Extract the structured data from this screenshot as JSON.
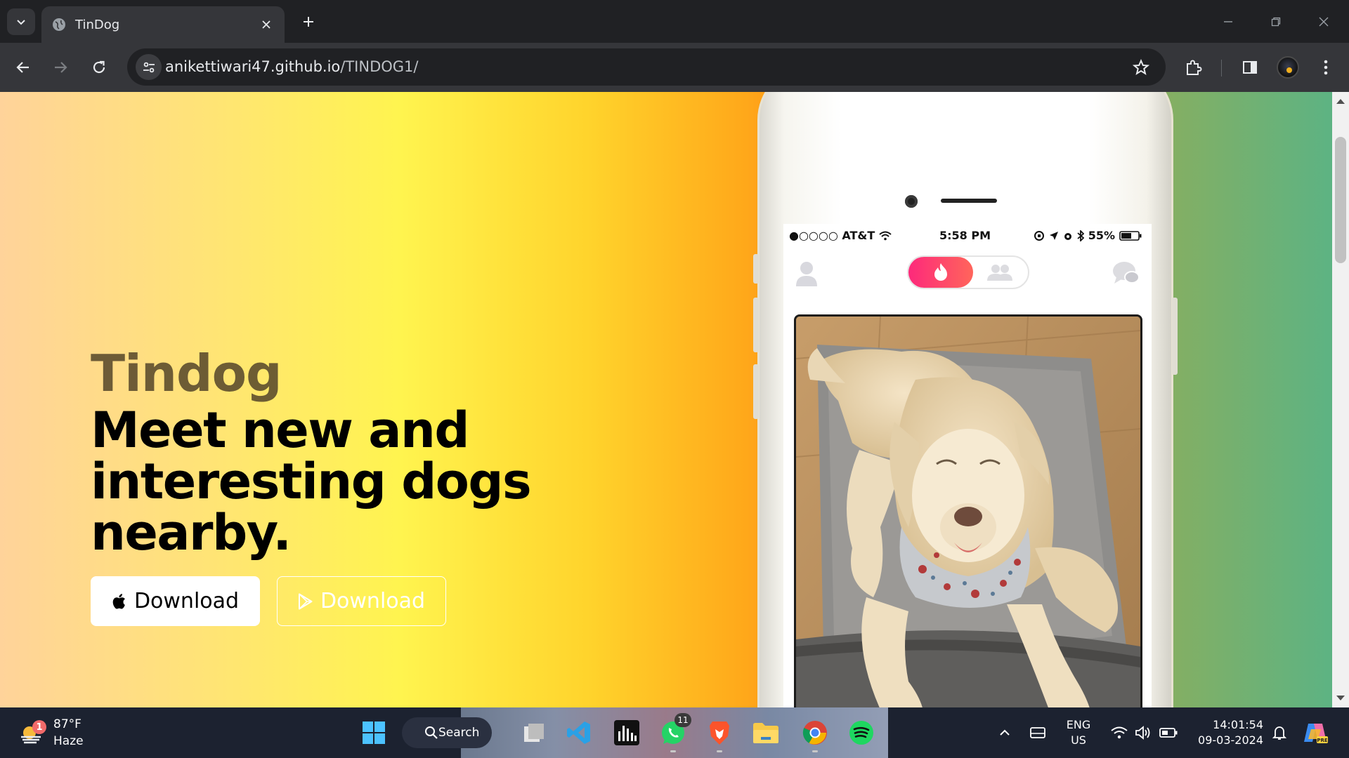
{
  "browser": {
    "tab_title": "TinDog",
    "url_host": "anikettiwari47.github.io",
    "url_path": "/TINDOG1/"
  },
  "page": {
    "brand": "Tindog",
    "headline": "Meet new and interesting dogs nearby.",
    "buttons": {
      "apple_download": "Download",
      "play_download": "Download"
    },
    "phone": {
      "carrier": "●○○○○ AT&T",
      "time": "5:58 PM",
      "battery": "55%"
    }
  },
  "taskbar": {
    "weather_temp": "87°F",
    "weather_condition": "Haze",
    "weather_badge": "1",
    "search_label": "Search",
    "whatsapp_badge": "11",
    "lang_top": "ENG",
    "lang_bottom": "US",
    "time": "14:01:54",
    "date": "09-03-2024"
  },
  "colors": {
    "accent_tinder_start": "#fd297b",
    "accent_tinder_end": "#ff655b",
    "chrome_dark": "#202124",
    "chrome_toolbar": "#35363a"
  }
}
